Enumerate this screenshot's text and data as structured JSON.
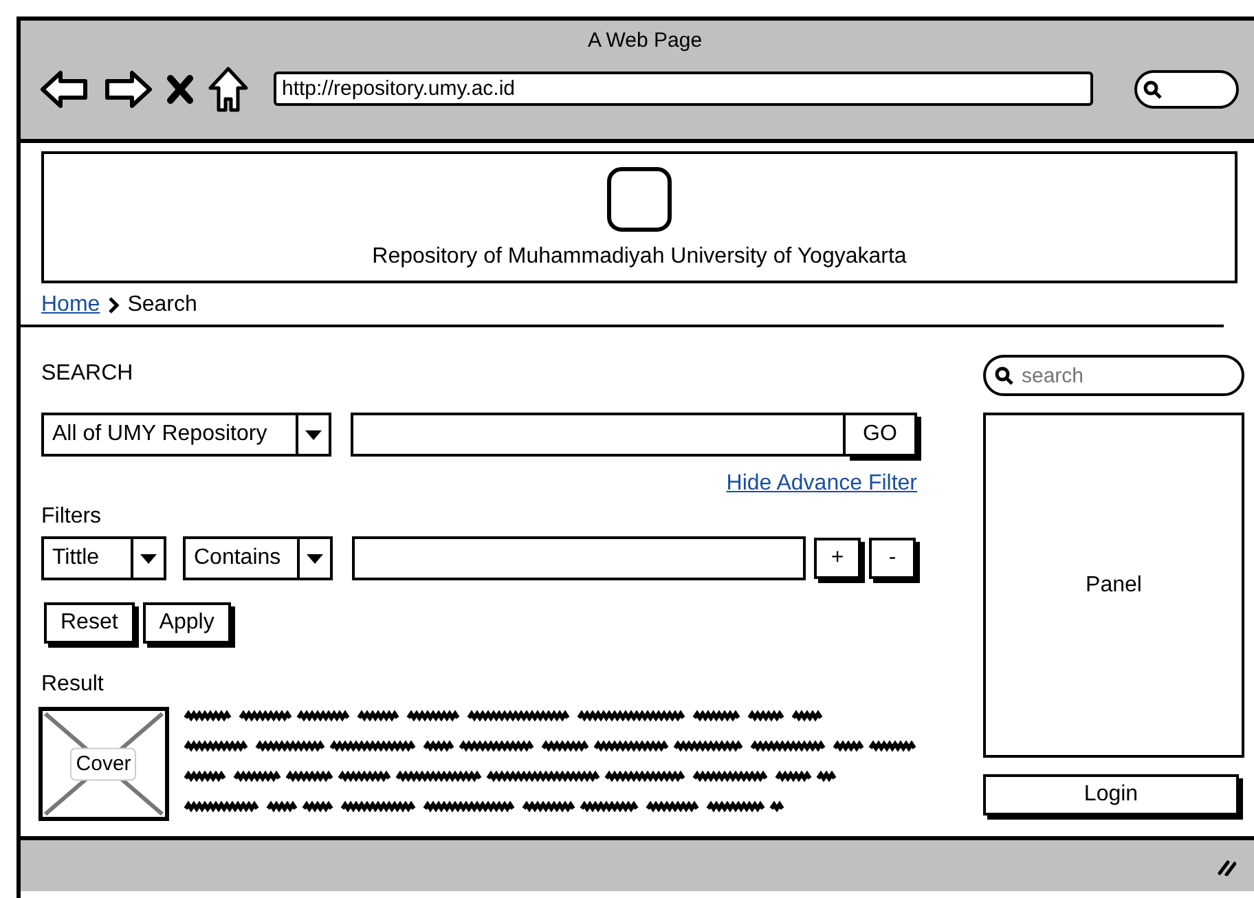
{
  "window": {
    "title": "A Web Page",
    "address": "http://repository.umy.ac.id"
  },
  "header": {
    "site_name": "Repository of Muhammadiyah University of Yogyakarta"
  },
  "breadcrumb": [
    {
      "label": "Home",
      "kind": "link"
    },
    {
      "label": "Search",
      "kind": "current"
    }
  ],
  "search": {
    "heading": "SEARCH",
    "scope": "All of UMY Repository",
    "go": "GO",
    "toggle_link": "Hide Advance Filter"
  },
  "filters": {
    "heading": "Filters",
    "rows": [
      {
        "field": "Tittle",
        "operator": "Contains",
        "add": "+",
        "remove": "-"
      }
    ],
    "buttons": [
      "Reset",
      "Apply"
    ]
  },
  "result": {
    "heading": "Result",
    "items": [
      {
        "cover_label": "Cover"
      }
    ]
  },
  "sidebar": {
    "search_placeholder": "search",
    "panel_label": "Panel",
    "login": "Login"
  }
}
